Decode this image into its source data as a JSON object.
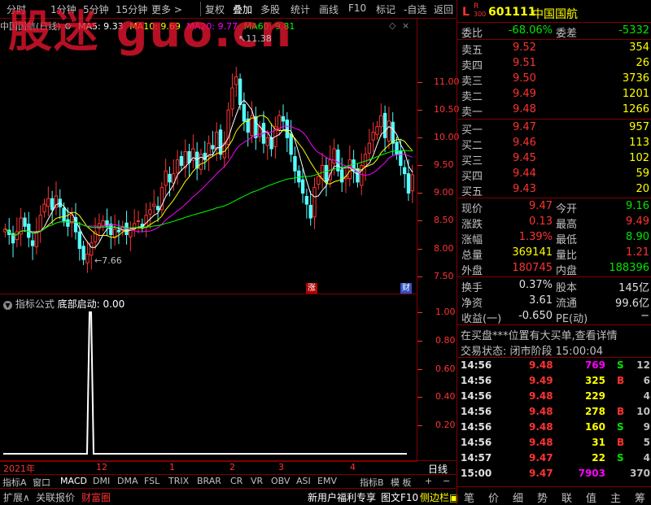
{
  "toolbar": {
    "items": [
      "分时",
      "1分钟",
      "5分钟",
      "15分钟",
      "更多 >",
      "复权",
      "叠加",
      "多股",
      "统计",
      "画线",
      "F10",
      "标记",
      "-自选",
      "返回"
    ]
  },
  "chart": {
    "stock_label": "中国国航(日线)",
    "ma": [
      {
        "label": "MA5: 9.33",
        "color": "#ffffff"
      },
      {
        "label": "MA10: 9.69",
        "color": "#ffff00"
      },
      {
        "label": "MA20: 9.77",
        "color": "#ff00ff"
      },
      {
        "label": "MA60: 9.81",
        "color": "#00ff00"
      }
    ],
    "watermark": "股迷 guo.cn",
    "high_marker": "11.38",
    "low_marker": "←7.66",
    "badge_zhang": "涨",
    "badge_cai": "财",
    "indicator_title": "指标公式",
    "indicator_value": "底部启动: 0.00",
    "date_labels": [
      "2021年",
      "12",
      "1",
      "2",
      "3",
      "4"
    ],
    "zoom_label": "日线"
  },
  "chart_data": [
    {
      "type": "candlestick",
      "title": "中国国航(日线)",
      "ylim": [
        7.2,
        11.9
      ],
      "yticks": [
        7.5,
        8.0,
        8.5,
        9.0,
        9.5,
        10.0,
        10.5,
        11.0
      ],
      "x_labels": [
        "2021年",
        "12",
        "1",
        "2",
        "3",
        "4"
      ],
      "series": [
        {
          "name": "MA5",
          "last": 9.33,
          "color": "#ffffff"
        },
        {
          "name": "MA10",
          "last": 9.69,
          "color": "#ffff00"
        },
        {
          "name": "MA20",
          "last": 9.77,
          "color": "#ff00ff"
        },
        {
          "name": "MA60",
          "last": 9.81,
          "color": "#00ff00"
        }
      ],
      "closes": [
        8.35,
        8.25,
        8.1,
        8.3,
        8.55,
        8.4,
        8.2,
        8.05,
        8.3,
        8.6,
        8.8,
        8.9,
        8.7,
        8.95,
        8.75,
        8.5,
        8.4,
        8.6,
        8.3,
        8.0,
        7.8,
        7.9,
        8.1,
        8.3,
        8.45,
        8.5,
        8.4,
        8.25,
        8.35,
        8.3,
        8.4,
        8.25,
        8.35,
        8.45,
        8.5,
        8.4,
        8.6,
        8.7,
        8.8,
        8.7,
        9.1,
        9.4,
        9.2,
        9.35,
        9.6,
        9.5,
        9.75,
        9.55,
        9.8,
        9.45,
        9.7,
        9.6,
        9.9,
        9.8,
        10.1,
        9.7,
        9.9,
        10.5,
        10.9,
        11.1,
        10.6,
        10.3,
        10.1,
        10.4,
        10.0,
        10.2,
        9.9,
        10.0,
        9.8,
        10.2,
        10.4,
        10.3,
        10.0,
        9.7,
        9.4,
        9.2,
        9.0,
        8.8,
        8.55,
        9.1,
        9.3,
        9.5,
        9.2,
        9.6,
        9.8,
        9.4,
        9.2,
        9.3,
        9.6,
        9.4,
        9.2,
        9.5,
        9.7,
        9.9,
        10.1,
        10.2,
        10.4,
        10.0,
        10.3,
        9.9,
        9.7,
        9.5,
        9.35,
        9.0,
        9.33
      ],
      "low_point": 7.66,
      "high_point": 11.38
    },
    {
      "type": "line",
      "title": "底部启动",
      "ylim": [
        0,
        1.0
      ],
      "yticks": [
        0.2,
        0.4,
        0.6,
        0.8,
        1.0
      ],
      "signal_index": 19,
      "signal_value": 1.0,
      "current": 0.0
    }
  ],
  "right": {
    "l_tag": "L",
    "r_tag": "R",
    "r_sub": "300",
    "code": "601111",
    "name": "中国国航",
    "weibi_label": "委比",
    "weibi": "-68.06%",
    "weicha_label": "委差",
    "weicha": "-5332",
    "asks": [
      {
        "label": "卖五",
        "price": "9.52",
        "vol": "354"
      },
      {
        "label": "卖四",
        "price": "9.51",
        "vol": "26"
      },
      {
        "label": "卖三",
        "price": "9.50",
        "vol": "3736"
      },
      {
        "label": "卖二",
        "price": "9.49",
        "vol": "1201"
      },
      {
        "label": "卖一",
        "price": "9.48",
        "vol": "1266"
      }
    ],
    "bids": [
      {
        "label": "买一",
        "price": "9.47",
        "vol": "957"
      },
      {
        "label": "买二",
        "price": "9.46",
        "vol": "113"
      },
      {
        "label": "买三",
        "price": "9.45",
        "vol": "102"
      },
      {
        "label": "买四",
        "price": "9.44",
        "vol": "59"
      },
      {
        "label": "买五",
        "price": "9.43",
        "vol": "20"
      }
    ],
    "quote": [
      {
        "l1": "现价",
        "v1": "9.47",
        "c1": "red",
        "l2": "今开",
        "v2": "9.16",
        "c2": "green"
      },
      {
        "l1": "涨跌",
        "v1": "0.13",
        "c1": "red",
        "l2": "最高",
        "v2": "9.49",
        "c2": "red"
      },
      {
        "l1": "涨幅",
        "v1": "1.39%",
        "c1": "red",
        "l2": "最低",
        "v2": "8.90",
        "c2": "green"
      },
      {
        "l1": "总量",
        "v1": "369141",
        "c1": "yellow",
        "l2": "量比",
        "v2": "1.21",
        "c2": "red"
      },
      {
        "l1": "外盘",
        "v1": "180745",
        "c1": "red",
        "l2": "内盘",
        "v2": "188396",
        "c2": "green"
      }
    ],
    "stats": [
      {
        "l1": "换手",
        "v1": "0.37%",
        "l2": "股本",
        "v2": "145亿"
      },
      {
        "l1": "净资",
        "v1": "3.61",
        "l2": "流通",
        "v2": "99.6亿"
      },
      {
        "l1": "收益(一)",
        "v1": "-0.650",
        "l2": "PE(动)",
        "v2": "−"
      }
    ],
    "notice": "在买盘***位置有大买单,查看详情",
    "status": "交易状态: 闭市阶段  15:00:04",
    "ticks": [
      {
        "t": "14:56",
        "p": "9.48",
        "v": "769",
        "vc": "magenta",
        "d": "S",
        "dc": "green",
        "n": "12"
      },
      {
        "t": "14:56",
        "p": "9.49",
        "v": "325",
        "vc": "yellow",
        "d": "B",
        "dc": "red",
        "n": "6"
      },
      {
        "t": "14:56",
        "p": "9.48",
        "v": "229",
        "vc": "yellow",
        "d": "",
        "dc": "green",
        "n": "4"
      },
      {
        "t": "14:56",
        "p": "9.48",
        "v": "278",
        "vc": "yellow",
        "d": "B",
        "dc": "red",
        "n": "10"
      },
      {
        "t": "14:56",
        "p": "9.48",
        "v": "160",
        "vc": "yellow",
        "d": "S",
        "dc": "green",
        "n": "9"
      },
      {
        "t": "14:56",
        "p": "9.48",
        "v": "31",
        "vc": "yellow",
        "d": "B",
        "dc": "red",
        "n": "5"
      },
      {
        "t": "14:57",
        "p": "9.47",
        "v": "22",
        "vc": "yellow",
        "d": "S",
        "dc": "green",
        "n": "4"
      },
      {
        "t": "15:00",
        "p": "9.47",
        "v": "7903",
        "vc": "magenta",
        "d": "",
        "dc": "green",
        "n": "370"
      }
    ],
    "bottom_buttons": [
      "笔",
      "价",
      "细",
      "势",
      "联",
      "值",
      "主",
      "筹"
    ]
  },
  "bottom": {
    "tabs": [
      "指标A",
      "窗口",
      "MACD",
      "DMI",
      "DMA",
      "FSL",
      "TRIX",
      "BRAR",
      "CR",
      "VR",
      "OBV",
      "ASI",
      "EMV",
      "指标B",
      "模 板",
      "+",
      "−"
    ],
    "tabs2": [
      "扩展∧",
      "关联报价",
      "财富圈",
      "新用户福利专享",
      "图文F10",
      "侧边栏"
    ]
  }
}
